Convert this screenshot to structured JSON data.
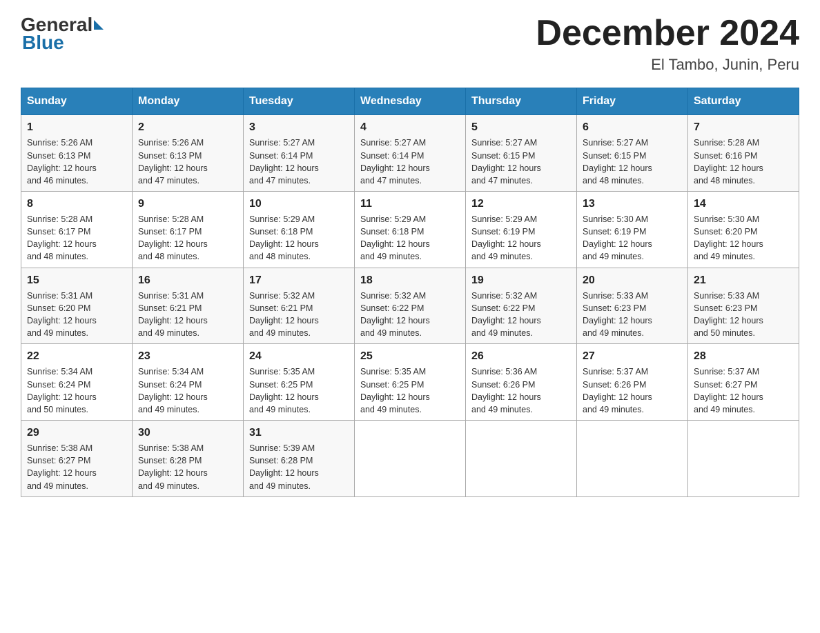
{
  "header": {
    "logo_general": "General",
    "logo_blue": "Blue",
    "month_title": "December 2024",
    "location": "El Tambo, Junin, Peru"
  },
  "days_of_week": [
    "Sunday",
    "Monday",
    "Tuesday",
    "Wednesday",
    "Thursday",
    "Friday",
    "Saturday"
  ],
  "weeks": [
    [
      {
        "day": "1",
        "sunrise": "5:26 AM",
        "sunset": "6:13 PM",
        "daylight": "12 hours and 46 minutes."
      },
      {
        "day": "2",
        "sunrise": "5:26 AM",
        "sunset": "6:13 PM",
        "daylight": "12 hours and 47 minutes."
      },
      {
        "day": "3",
        "sunrise": "5:27 AM",
        "sunset": "6:14 PM",
        "daylight": "12 hours and 47 minutes."
      },
      {
        "day": "4",
        "sunrise": "5:27 AM",
        "sunset": "6:14 PM",
        "daylight": "12 hours and 47 minutes."
      },
      {
        "day": "5",
        "sunrise": "5:27 AM",
        "sunset": "6:15 PM",
        "daylight": "12 hours and 47 minutes."
      },
      {
        "day": "6",
        "sunrise": "5:27 AM",
        "sunset": "6:15 PM",
        "daylight": "12 hours and 48 minutes."
      },
      {
        "day": "7",
        "sunrise": "5:28 AM",
        "sunset": "6:16 PM",
        "daylight": "12 hours and 48 minutes."
      }
    ],
    [
      {
        "day": "8",
        "sunrise": "5:28 AM",
        "sunset": "6:17 PM",
        "daylight": "12 hours and 48 minutes."
      },
      {
        "day": "9",
        "sunrise": "5:28 AM",
        "sunset": "6:17 PM",
        "daylight": "12 hours and 48 minutes."
      },
      {
        "day": "10",
        "sunrise": "5:29 AM",
        "sunset": "6:18 PM",
        "daylight": "12 hours and 48 minutes."
      },
      {
        "day": "11",
        "sunrise": "5:29 AM",
        "sunset": "6:18 PM",
        "daylight": "12 hours and 49 minutes."
      },
      {
        "day": "12",
        "sunrise": "5:29 AM",
        "sunset": "6:19 PM",
        "daylight": "12 hours and 49 minutes."
      },
      {
        "day": "13",
        "sunrise": "5:30 AM",
        "sunset": "6:19 PM",
        "daylight": "12 hours and 49 minutes."
      },
      {
        "day": "14",
        "sunrise": "5:30 AM",
        "sunset": "6:20 PM",
        "daylight": "12 hours and 49 minutes."
      }
    ],
    [
      {
        "day": "15",
        "sunrise": "5:31 AM",
        "sunset": "6:20 PM",
        "daylight": "12 hours and 49 minutes."
      },
      {
        "day": "16",
        "sunrise": "5:31 AM",
        "sunset": "6:21 PM",
        "daylight": "12 hours and 49 minutes."
      },
      {
        "day": "17",
        "sunrise": "5:32 AM",
        "sunset": "6:21 PM",
        "daylight": "12 hours and 49 minutes."
      },
      {
        "day": "18",
        "sunrise": "5:32 AM",
        "sunset": "6:22 PM",
        "daylight": "12 hours and 49 minutes."
      },
      {
        "day": "19",
        "sunrise": "5:32 AM",
        "sunset": "6:22 PM",
        "daylight": "12 hours and 49 minutes."
      },
      {
        "day": "20",
        "sunrise": "5:33 AM",
        "sunset": "6:23 PM",
        "daylight": "12 hours and 49 minutes."
      },
      {
        "day": "21",
        "sunrise": "5:33 AM",
        "sunset": "6:23 PM",
        "daylight": "12 hours and 50 minutes."
      }
    ],
    [
      {
        "day": "22",
        "sunrise": "5:34 AM",
        "sunset": "6:24 PM",
        "daylight": "12 hours and 50 minutes."
      },
      {
        "day": "23",
        "sunrise": "5:34 AM",
        "sunset": "6:24 PM",
        "daylight": "12 hours and 49 minutes."
      },
      {
        "day": "24",
        "sunrise": "5:35 AM",
        "sunset": "6:25 PM",
        "daylight": "12 hours and 49 minutes."
      },
      {
        "day": "25",
        "sunrise": "5:35 AM",
        "sunset": "6:25 PM",
        "daylight": "12 hours and 49 minutes."
      },
      {
        "day": "26",
        "sunrise": "5:36 AM",
        "sunset": "6:26 PM",
        "daylight": "12 hours and 49 minutes."
      },
      {
        "day": "27",
        "sunrise": "5:37 AM",
        "sunset": "6:26 PM",
        "daylight": "12 hours and 49 minutes."
      },
      {
        "day": "28",
        "sunrise": "5:37 AM",
        "sunset": "6:27 PM",
        "daylight": "12 hours and 49 minutes."
      }
    ],
    [
      {
        "day": "29",
        "sunrise": "5:38 AM",
        "sunset": "6:27 PM",
        "daylight": "12 hours and 49 minutes."
      },
      {
        "day": "30",
        "sunrise": "5:38 AM",
        "sunset": "6:28 PM",
        "daylight": "12 hours and 49 minutes."
      },
      {
        "day": "31",
        "sunrise": "5:39 AM",
        "sunset": "6:28 PM",
        "daylight": "12 hours and 49 minutes."
      },
      null,
      null,
      null,
      null
    ]
  ],
  "labels": {
    "sunrise": "Sunrise:",
    "sunset": "Sunset:",
    "daylight": "Daylight:"
  }
}
